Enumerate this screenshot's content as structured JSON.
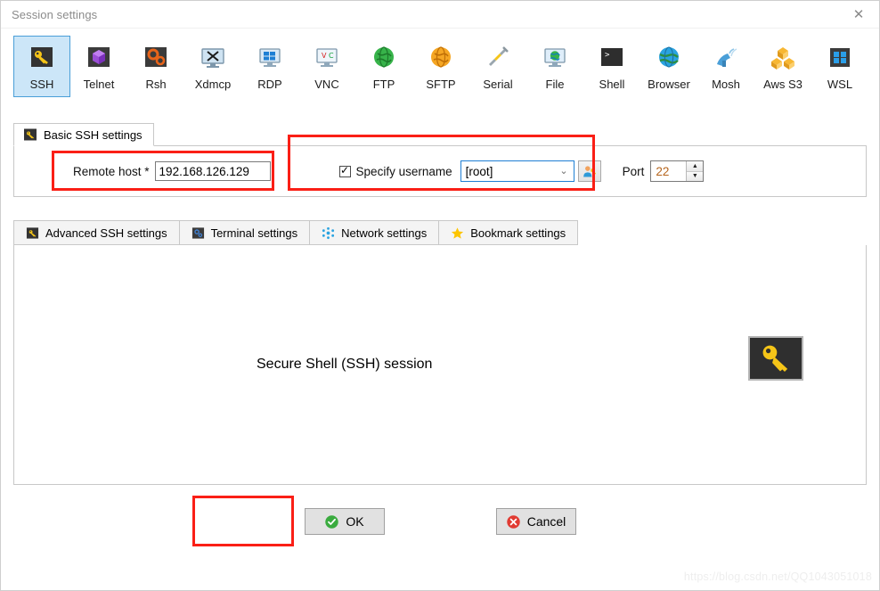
{
  "window": {
    "title": "Session settings",
    "close_label": "✕"
  },
  "session_types": [
    {
      "label": "SSH",
      "icon": "ssh-key-icon",
      "selected": true
    },
    {
      "label": "Telnet",
      "icon": "telnet-cube-icon",
      "selected": false
    },
    {
      "label": "Rsh",
      "icon": "rsh-gears-icon",
      "selected": false
    },
    {
      "label": "Xdmcp",
      "icon": "xdmcp-monitor-icon",
      "selected": false
    },
    {
      "label": "RDP",
      "icon": "rdp-windows-icon",
      "selected": false
    },
    {
      "label": "VNC",
      "icon": "vnc-monitor-icon",
      "selected": false
    },
    {
      "label": "FTP",
      "icon": "ftp-globe-green-icon",
      "selected": false
    },
    {
      "label": "SFTP",
      "icon": "sftp-globe-orange-icon",
      "selected": false
    },
    {
      "label": "Serial",
      "icon": "serial-plug-icon",
      "selected": false
    },
    {
      "label": "File",
      "icon": "file-monitor-icon",
      "selected": false
    },
    {
      "label": "Shell",
      "icon": "shell-terminal-icon",
      "selected": false
    },
    {
      "label": "Browser",
      "icon": "browser-globe-icon",
      "selected": false
    },
    {
      "label": "Mosh",
      "icon": "mosh-satellite-icon",
      "selected": false
    },
    {
      "label": "Aws S3",
      "icon": "aws-s3-buckets-icon",
      "selected": false
    },
    {
      "label": "WSL",
      "icon": "wsl-windows-icon",
      "selected": false
    }
  ],
  "basic_tab": {
    "label": "Basic SSH settings",
    "icon": "ssh-key-icon",
    "remote_host": {
      "label": "Remote host *",
      "value": "192.168.126.129",
      "placeholder": ""
    },
    "specify_username": {
      "label": "Specify username",
      "checked": true,
      "check_glyph": "✓",
      "value": "[root]",
      "chevron": "⌄",
      "picker_icon": "user-key-icon"
    },
    "port": {
      "label": "Port",
      "value": "22",
      "up_glyph": "▲",
      "down_glyph": "▼"
    }
  },
  "sub_tabs": [
    {
      "label": "Advanced SSH settings",
      "icon": "ssh-key-icon"
    },
    {
      "label": "Terminal settings",
      "icon": "terminal-gear-icon"
    },
    {
      "label": "Network settings",
      "icon": "network-nodes-icon"
    },
    {
      "label": "Bookmark settings",
      "icon": "star-icon"
    }
  ],
  "panel": {
    "caption": "Secure Shell (SSH) session",
    "icon": "ssh-key-large-icon"
  },
  "footer": {
    "ok": {
      "label": "OK",
      "icon": "check-circle-green-icon"
    },
    "cancel": {
      "label": "Cancel",
      "icon": "x-circle-red-icon"
    }
  },
  "watermark": "https://blog.csdn.net/QQ1043051018",
  "colors": {
    "selection_bg": "#cce6f8",
    "selection_border": "#4a9fd8",
    "annotation_red": "#fa1f16",
    "ok_green": "#3aab3f",
    "cancel_red": "#e13b32",
    "key_yellow": "#f5c518",
    "port_value": "#b5651d"
  }
}
